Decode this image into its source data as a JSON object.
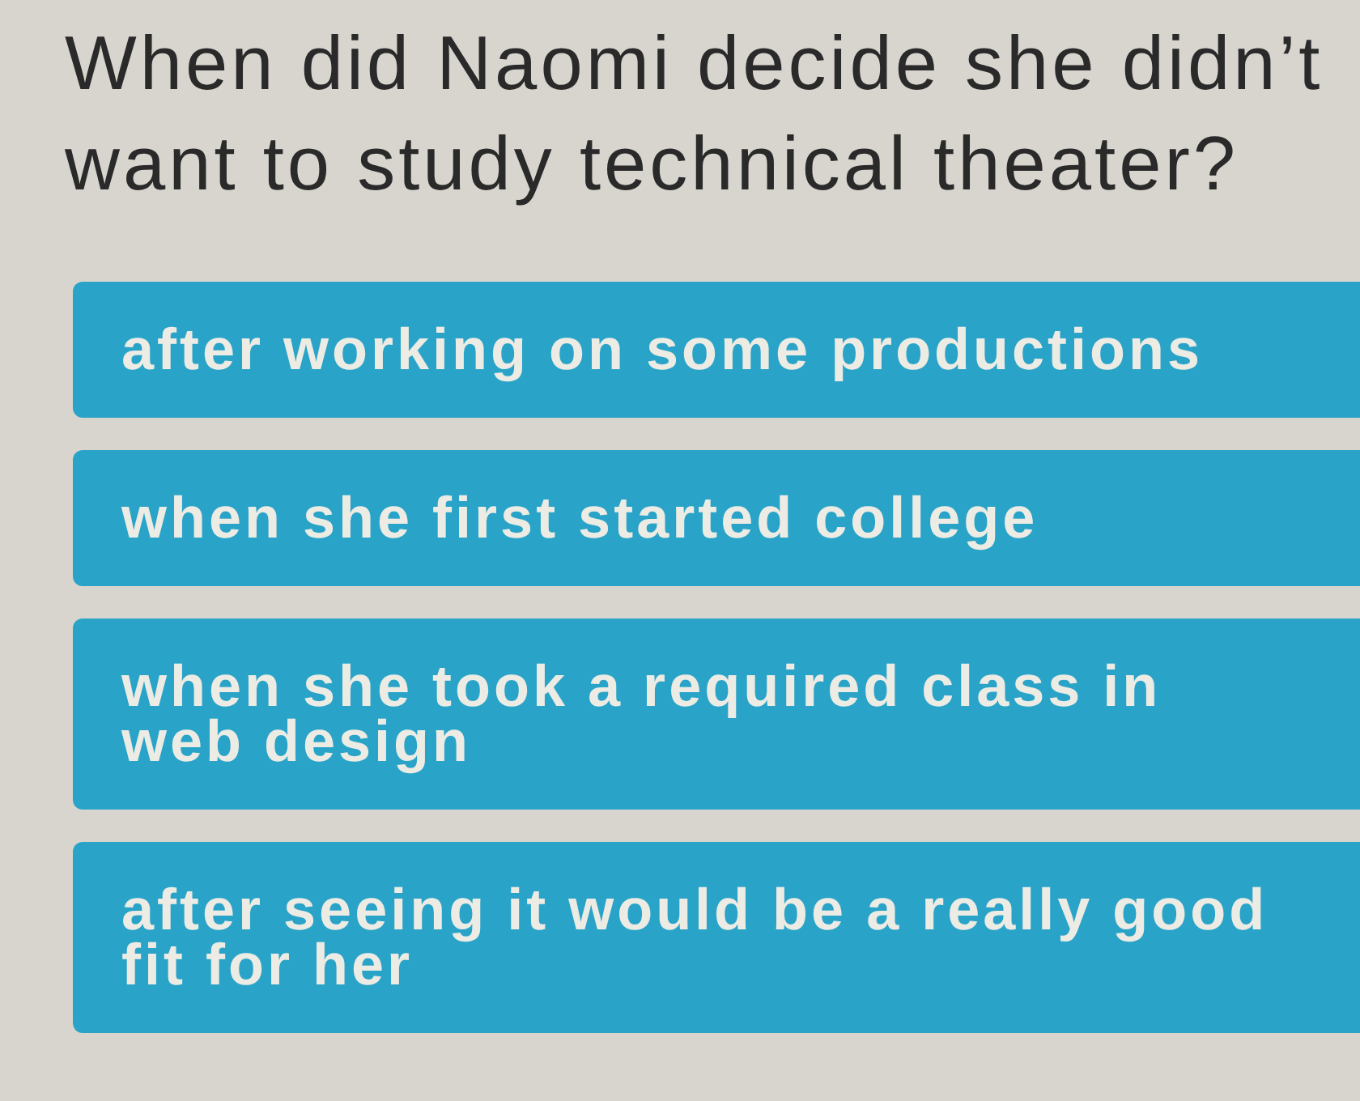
{
  "question": "When did Naomi decide she didn’t want to study technical theater?",
  "options": [
    "after working on some productions",
    "when she first started college",
    "when she took a required class in web design",
    "after seeing it would be a really good fit for her"
  ]
}
